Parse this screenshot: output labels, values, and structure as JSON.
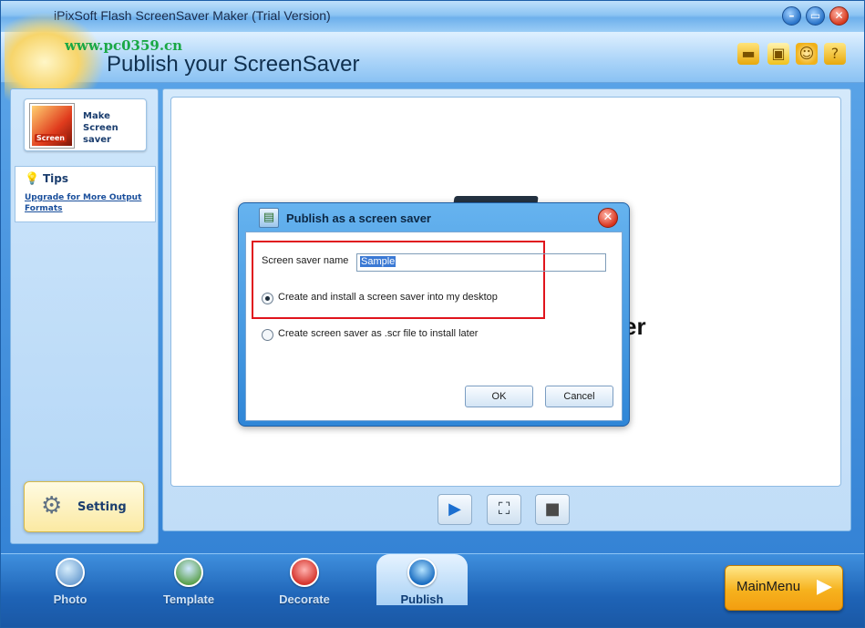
{
  "window": {
    "title": "iPixSoft Flash ScreenSaver Maker (Trial Version)",
    "controls": {
      "minimize": "–",
      "maximize": "▭",
      "close": "✕"
    }
  },
  "header": {
    "watermark": "www.pc0359.cn",
    "subtitle": "Publish your ScreenSaver",
    "icons": [
      "folder-icon",
      "save-icon",
      "help-person-icon",
      "help-question-icon"
    ]
  },
  "sidebar": {
    "make": {
      "label_line1": "Make",
      "label_line2": "Screen saver",
      "thumb_text": "Screen"
    },
    "tips": {
      "title": "Tips",
      "link": "Upgrade for More Output Formats"
    },
    "setting": {
      "label": "Setting"
    }
  },
  "preview": {
    "background_text": "er"
  },
  "controls": {
    "play": "▶",
    "fullscreen": "⛶",
    "stop": "■"
  },
  "dialog": {
    "title": "Publish as a screen saver",
    "name_label": "Screen saver name",
    "name_value": "Sample",
    "option_install": "Create and install a screen saver into my desktop",
    "option_scr": "Create screen saver as .scr file to install later",
    "selected_option": "install",
    "ok": "OK",
    "cancel": "Cancel",
    "highlight_color": "#e0141c"
  },
  "bottom_nav": {
    "tabs": [
      {
        "label": "Photo"
      },
      {
        "label": "Template"
      },
      {
        "label": "Decorate"
      },
      {
        "label": "Publish",
        "active": true
      }
    ],
    "main_menu": "MainMenu"
  }
}
